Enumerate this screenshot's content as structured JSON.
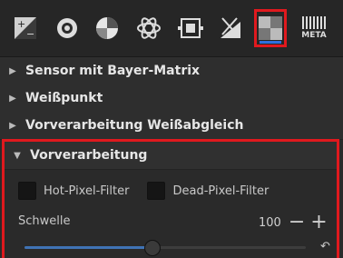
{
  "toolbar": {
    "icons": [
      {
        "name": "exposure-icon"
      },
      {
        "name": "detail-icon"
      },
      {
        "name": "color-icon"
      },
      {
        "name": "advanced-icon"
      },
      {
        "name": "transform-icon"
      },
      {
        "name": "raw-icon"
      },
      {
        "name": "raw-tab-icon"
      },
      {
        "name": "meta-icon",
        "label": "META"
      }
    ],
    "active_index": 6
  },
  "panels": [
    {
      "title": "Sensor mit Bayer-Matrix",
      "expanded": false
    },
    {
      "title": "Weißpunkt",
      "expanded": false
    },
    {
      "title": "Vorverarbeitung Weißabgleich",
      "expanded": false
    }
  ],
  "preprocessing": {
    "title": "Vorverarbeitung",
    "hot_pixel_label": "Hot-Pixel-Filter",
    "dead_pixel_label": "Dead-Pixel-Filter",
    "threshold_label": "Schwelle",
    "threshold_value": "100",
    "threshold_fraction": 0.45
  },
  "colors": {
    "accent": "#e0191e",
    "active_underline": "#2f6fdd",
    "slider": "#3f73b5"
  }
}
